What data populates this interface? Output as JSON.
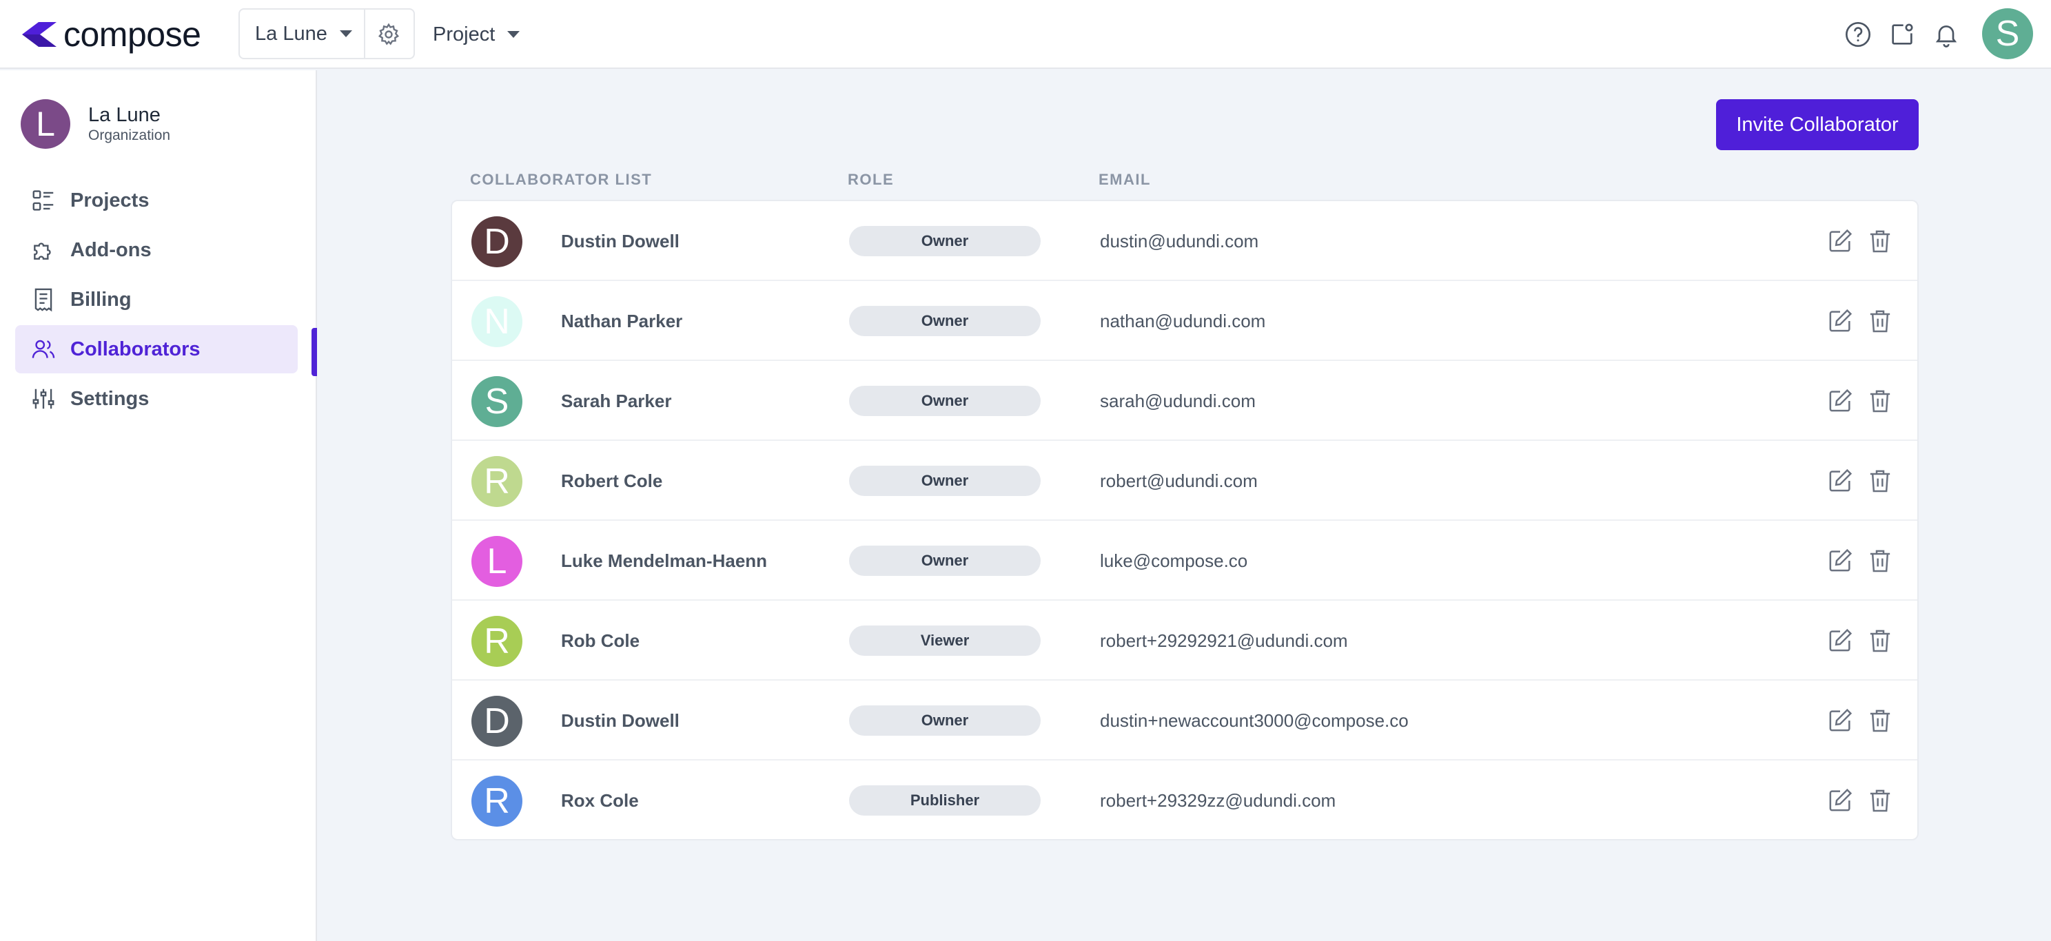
{
  "header": {
    "logo_text": "compose",
    "org_selector": "La Lune",
    "project_selector": "Project",
    "user_initial": "S"
  },
  "sidebar": {
    "org_initial": "L",
    "org_name": "La Lune",
    "org_type": "Organization",
    "items": [
      {
        "label": "Projects",
        "icon": "projects-list-icon"
      },
      {
        "label": "Add-ons",
        "icon": "puzzle-icon"
      },
      {
        "label": "Billing",
        "icon": "receipt-icon"
      },
      {
        "label": "Collaborators",
        "icon": "users-icon",
        "active": true
      },
      {
        "label": "Settings",
        "icon": "sliders-icon"
      }
    ]
  },
  "main": {
    "invite_button": "Invite Collaborator",
    "columns": {
      "collaborator": "COLLABORATOR LIST",
      "role": "ROLE",
      "email": "EMAIL"
    },
    "collaborators": [
      {
        "initial": "D",
        "name": "Dustin Dowell",
        "role": "Owner",
        "email": "dustin@udundi.com",
        "avatar_color": "#5a3a3e"
      },
      {
        "initial": "N",
        "name": "Nathan Parker",
        "role": "Owner",
        "email": "nathan@udundi.com",
        "avatar_color": "#dcfaf4"
      },
      {
        "initial": "S",
        "name": "Sarah Parker",
        "role": "Owner",
        "email": "sarah@udundi.com",
        "avatar_color": "#5fae94"
      },
      {
        "initial": "R",
        "name": "Robert Cole",
        "role": "Owner",
        "email": "robert@udundi.com",
        "avatar_color": "#bfd98f"
      },
      {
        "initial": "L",
        "name": "Luke Mendelman-Haenn",
        "role": "Owner",
        "email": "luke@compose.co",
        "avatar_color": "#e35ee0"
      },
      {
        "initial": "R",
        "name": "Rob Cole",
        "role": "Viewer",
        "email": "robert+29292921@udundi.com",
        "avatar_color": "#a8cd55"
      },
      {
        "initial": "D",
        "name": "Dustin Dowell",
        "role": "Owner",
        "email": "dustin+newaccount3000@compose.co",
        "avatar_color": "#5b636b"
      },
      {
        "initial": "R",
        "name": "Rox Cole",
        "role": "Publisher",
        "email": "robert+29329zz@udundi.com",
        "avatar_color": "#5b8fe6"
      }
    ]
  },
  "colors": {
    "accent": "#4f1fd9",
    "sidebar_active_bg": "#ede8fb"
  }
}
